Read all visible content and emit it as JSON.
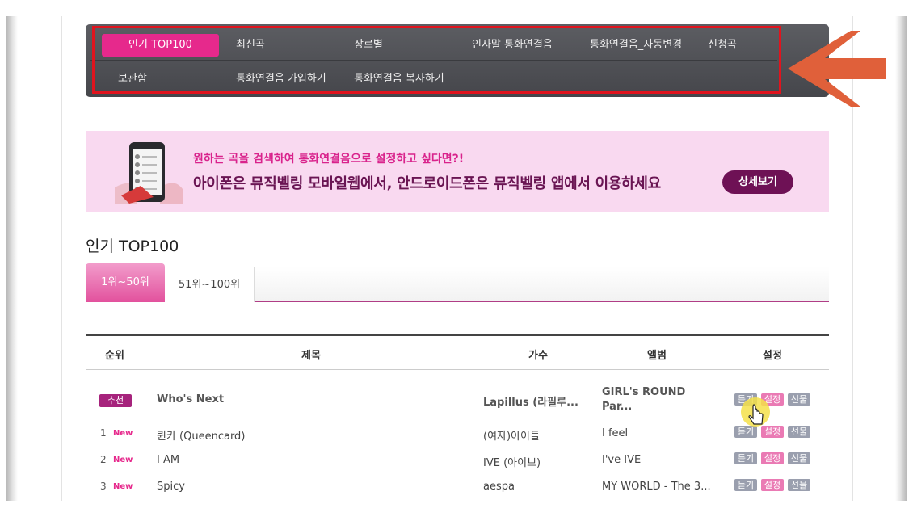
{
  "nav": {
    "row1": [
      "인기 TOP100",
      "최신곡",
      "장르별",
      "인사말 통화연결음",
      "통화연결음_자동변경",
      "신청곡"
    ],
    "row2": [
      "보관함",
      "통화연결음 가입하기",
      "통화연결음 복사하기"
    ]
  },
  "banner": {
    "line1": "원하는 곡을 검색하여 통화연결음으로 설정하고 싶다면?!",
    "line2": "아이폰은 뮤직벨링 모바일웹에서, 안드로이드폰은 뮤직벨링 앱에서 이용하세요",
    "button": "상세보기"
  },
  "section_title": "인기 TOP100",
  "tabs": [
    "1위~50위",
    "51위~100위"
  ],
  "table": {
    "headers": [
      "순위",
      "제목",
      "가수",
      "앨범",
      "설정"
    ],
    "recommended": {
      "badge": "추천",
      "title": "Who's Next",
      "artist": "Lapillus (라필루...",
      "album_line1": "GIRL's ROUND",
      "album_line2": "Par..."
    },
    "rows": [
      {
        "rank": "1",
        "badge": "New",
        "title": "퀸카 (Queencard)",
        "artist": "(여자)아이들",
        "album": "I feel"
      },
      {
        "rank": "2",
        "badge": "New",
        "title": "I AM",
        "artist": "IVE (아이브)",
        "album": "I've IVE"
      },
      {
        "rank": "3",
        "badge": "New",
        "title": "Spicy",
        "artist": "aespa",
        "album": "MY WORLD - The 3..."
      }
    ],
    "actions": {
      "listen": "듣기",
      "set": "설정",
      "gift": "선물"
    }
  },
  "colors": {
    "accent": "#e6298c",
    "nav_bg": "#4f5055",
    "banner_bg": "#f9d9f0",
    "highlight": "#e0141e",
    "arrow": "#e0603a"
  }
}
